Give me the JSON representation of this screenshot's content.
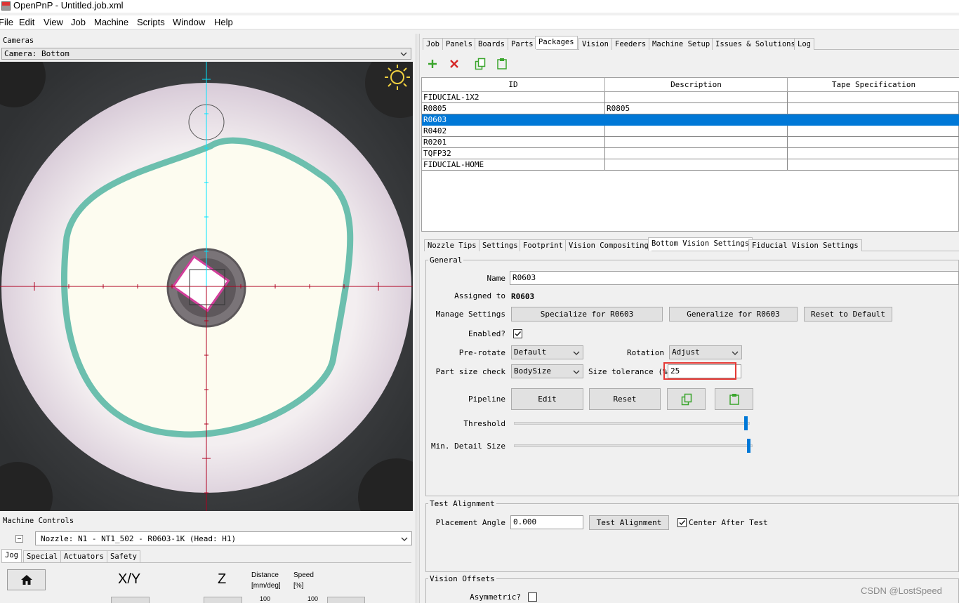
{
  "window": {
    "title": "OpenPnP - Untitled.job.xml"
  },
  "menu": [
    "File",
    "Edit",
    "View",
    "Job",
    "Machine",
    "Scripts",
    "Window",
    "Help"
  ],
  "cameras": {
    "label": "Cameras",
    "selected": "Camera: Bottom"
  },
  "machine_controls": {
    "label": "Machine Controls",
    "nozzle": "Nozzle: N1 - NT1_502 - R0603-1K (Head: H1)",
    "tabs": [
      "Jog",
      "Special",
      "Actuators",
      "Safety"
    ],
    "jog": {
      "xy_label": "X/Y",
      "z_label": "Z",
      "distance_label": "Distance",
      "distance_unit": "[mm/deg]",
      "speed_label": "Speed",
      "speed_unit": "[%]",
      "distance_value": "100",
      "speed_value": "100"
    }
  },
  "main_tabs": [
    "Job",
    "Panels",
    "Boards",
    "Parts",
    "Packages",
    "Vision",
    "Feeders",
    "Machine Setup",
    "Issues & Solutions",
    "Log"
  ],
  "main_tab_active": "Packages",
  "packages_table": {
    "columns": [
      "ID",
      "Description",
      "Tape Specification"
    ],
    "rows": [
      [
        "FIDUCIAL-1X2",
        "",
        ""
      ],
      [
        "R0805",
        "R0805",
        ""
      ],
      [
        "R0603",
        "",
        ""
      ],
      [
        "R0402",
        "",
        ""
      ],
      [
        "R0201",
        "",
        ""
      ],
      [
        "TQFP32",
        "",
        ""
      ],
      [
        "FIDUCIAL-HOME",
        "",
        ""
      ]
    ],
    "selected_row": 2
  },
  "sub_tabs": [
    "Nozzle Tips",
    "Settings",
    "Footprint",
    "Vision Compositing",
    "Bottom Vision Settings",
    "Fiducial Vision Settings"
  ],
  "sub_tab_active": "Bottom Vision Settings",
  "general": {
    "legend": "General",
    "name_label": "Name",
    "name_value": "R0603",
    "assigned_label": "Assigned to",
    "assigned_value": "R0603",
    "manage_label": "Manage Settings",
    "specialize_btn": "Specialize for  R0603",
    "generalize_btn": "Generalize for R0603",
    "reset_default_btn": "Reset to Default",
    "enabled_label": "Enabled?",
    "prerotate_label": "Pre-rotate",
    "prerotate_value": "Default",
    "rotation_label": "Rotation",
    "rotation_value": "Adjust",
    "partsize_label": "Part size check",
    "partsize_value": "BodySize",
    "tolerance_label": "Size tolerance  (%)",
    "tolerance_value": "25",
    "pipeline_label": "Pipeline",
    "edit_btn": "Edit",
    "reset_btn": "Reset",
    "threshold_label": "Threshold",
    "min_detail_label": "Min. Detail Size",
    "threshold_level": 0.99,
    "min_detail_level": 0.99
  },
  "test_alignment": {
    "legend": "Test Alignment",
    "placement_label": "Placement Angle",
    "placement_value": "0.000",
    "test_btn": "Test Alignment",
    "center_label": "Center After Test"
  },
  "vision_offsets": {
    "legend": "Vision Offsets",
    "asymmetric_label": "Asymmetric?"
  },
  "watermark": "CSDN @LostSpeed",
  "colors": {
    "selection": "#0078d7",
    "highlight_box": "#e53935",
    "crosshair_red": "#b00020",
    "crosshair_cyan": "#00e5ff",
    "green_icon": "#3aa52c",
    "red_icon": "#d52626"
  }
}
